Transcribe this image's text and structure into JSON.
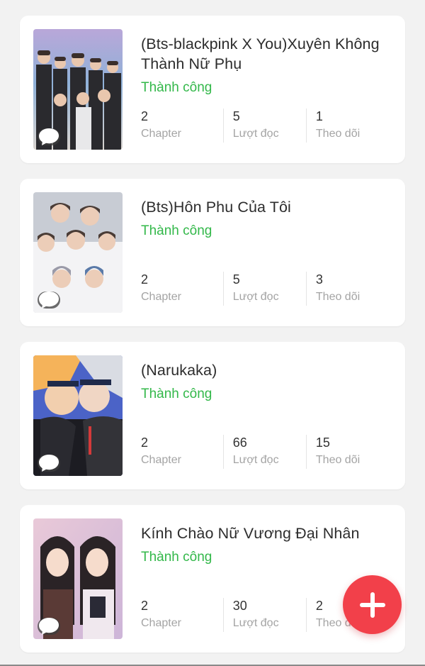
{
  "stories": [
    {
      "title": "(Bts-blackpink X You)Xuyên Không Thành Nữ Phụ",
      "status": "Thành công",
      "stats": [
        {
          "value": "2",
          "label": "Chapter"
        },
        {
          "value": "5",
          "label": "Lượt đọc"
        },
        {
          "value": "1",
          "label": "Theo dõi"
        }
      ]
    },
    {
      "title": "(Bts)Hôn Phu Của Tôi",
      "status": "Thành công",
      "stats": [
        {
          "value": "2",
          "label": "Chapter"
        },
        {
          "value": "5",
          "label": "Lượt đọc"
        },
        {
          "value": "3",
          "label": "Theo dõi"
        }
      ]
    },
    {
      "title": "(Narukaka)",
      "status": "Thành công",
      "stats": [
        {
          "value": "2",
          "label": "Chapter"
        },
        {
          "value": "66",
          "label": "Lượt đọc"
        },
        {
          "value": "15",
          "label": "Theo dõi"
        }
      ]
    },
    {
      "title": "Kính Chào Nữ Vương Đại Nhân",
      "status": "Thành công",
      "stats": [
        {
          "value": "2",
          "label": "Chapter"
        },
        {
          "value": "30",
          "label": "Lượt đọc"
        },
        {
          "value": "2",
          "label": "Theo dõi"
        }
      ]
    }
  ],
  "icons": {
    "comment": "comment-bubble-icon",
    "add": "plus-icon"
  },
  "colors": {
    "status_green": "#33b84a",
    "fab_red": "#f2404a",
    "background": "#f2f2f2"
  }
}
